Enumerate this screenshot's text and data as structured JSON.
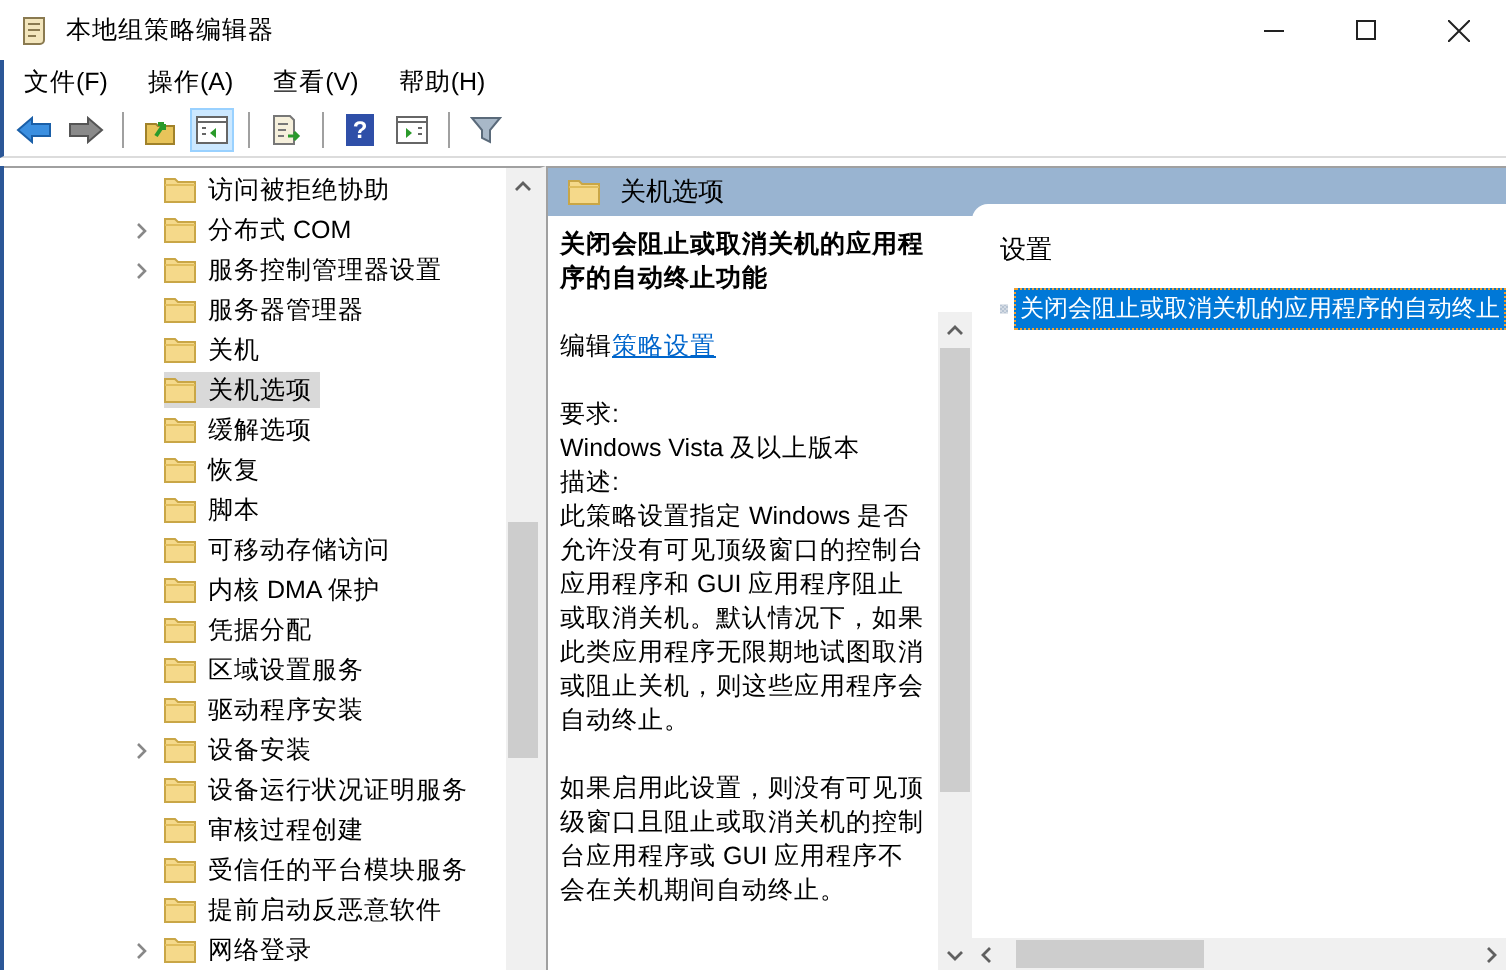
{
  "window": {
    "title": "本地组策略编辑器"
  },
  "menu": [
    "文件(F)",
    "操作(A)",
    "查看(V)",
    "帮助(H)"
  ],
  "toolbar": [
    [
      {
        "kind": "back",
        "pressed": false
      },
      {
        "kind": "forward",
        "pressed": false
      }
    ],
    [
      {
        "kind": "up",
        "pressed": false
      },
      {
        "kind": "tree",
        "pressed": true
      }
    ],
    [
      {
        "kind": "export",
        "pressed": false
      }
    ],
    [
      {
        "kind": "help",
        "pressed": false,
        "glyph": "?"
      },
      {
        "kind": "pane",
        "pressed": false
      }
    ],
    [
      {
        "kind": "filter",
        "pressed": false
      }
    ]
  ],
  "tree": {
    "items": [
      {
        "label": "访问被拒绝协助",
        "expandable": false,
        "selected": false
      },
      {
        "label": "分布式 COM",
        "expandable": true,
        "selected": false
      },
      {
        "label": "服务控制管理器设置",
        "expandable": true,
        "selected": false
      },
      {
        "label": "服务器管理器",
        "expandable": false,
        "selected": false
      },
      {
        "label": "关机",
        "expandable": false,
        "selected": false
      },
      {
        "label": "关机选项",
        "expandable": false,
        "selected": true
      },
      {
        "label": "缓解选项",
        "expandable": false,
        "selected": false
      },
      {
        "label": "恢复",
        "expandable": false,
        "selected": false
      },
      {
        "label": "脚本",
        "expandable": false,
        "selected": false
      },
      {
        "label": "可移动存储访问",
        "expandable": false,
        "selected": false
      },
      {
        "label": "内核 DMA 保护",
        "expandable": false,
        "selected": false
      },
      {
        "label": "凭据分配",
        "expandable": false,
        "selected": false
      },
      {
        "label": "区域设置服务",
        "expandable": false,
        "selected": false
      },
      {
        "label": "驱动程序安装",
        "expandable": false,
        "selected": false
      },
      {
        "label": "设备安装",
        "expandable": true,
        "selected": false
      },
      {
        "label": "设备运行状况证明服务",
        "expandable": false,
        "selected": false
      },
      {
        "label": "审核过程创建",
        "expandable": false,
        "selected": false
      },
      {
        "label": "受信任的平台模块服务",
        "expandable": false,
        "selected": false
      },
      {
        "label": "提前启动反恶意软件",
        "expandable": false,
        "selected": false
      },
      {
        "label": "网络登录",
        "expandable": true,
        "selected": false
      }
    ]
  },
  "details": {
    "header": "关机选项",
    "title": "关闭会阻止或取消关机的应用程序的自动终止功能",
    "edit_prefix": "编辑",
    "edit_link": "策略设置",
    "requirements_label": "要求:",
    "requirements": "Windows Vista 及以上版本",
    "description_label": "描述:",
    "paragraphs": [
      "此策略设置指定 Windows 是否允许没有可见顶级窗口的控制台应用程序和 GUI 应用程序阻止或取消关机。默认情况下，如果此类应用程序无限期地试图取消或阻止关机，则这些应用程序会自动终止。",
      "如果启用此设置，则没有可见顶级窗口且阻止或取消关机的控制台应用程序或 GUI 应用程序不会在关机期间自动终止。"
    ]
  },
  "settings": {
    "column": "设置",
    "rows": [
      {
        "label": "关闭会阻止或取消关机的应用程序的自动终止",
        "selected": true
      }
    ]
  }
}
